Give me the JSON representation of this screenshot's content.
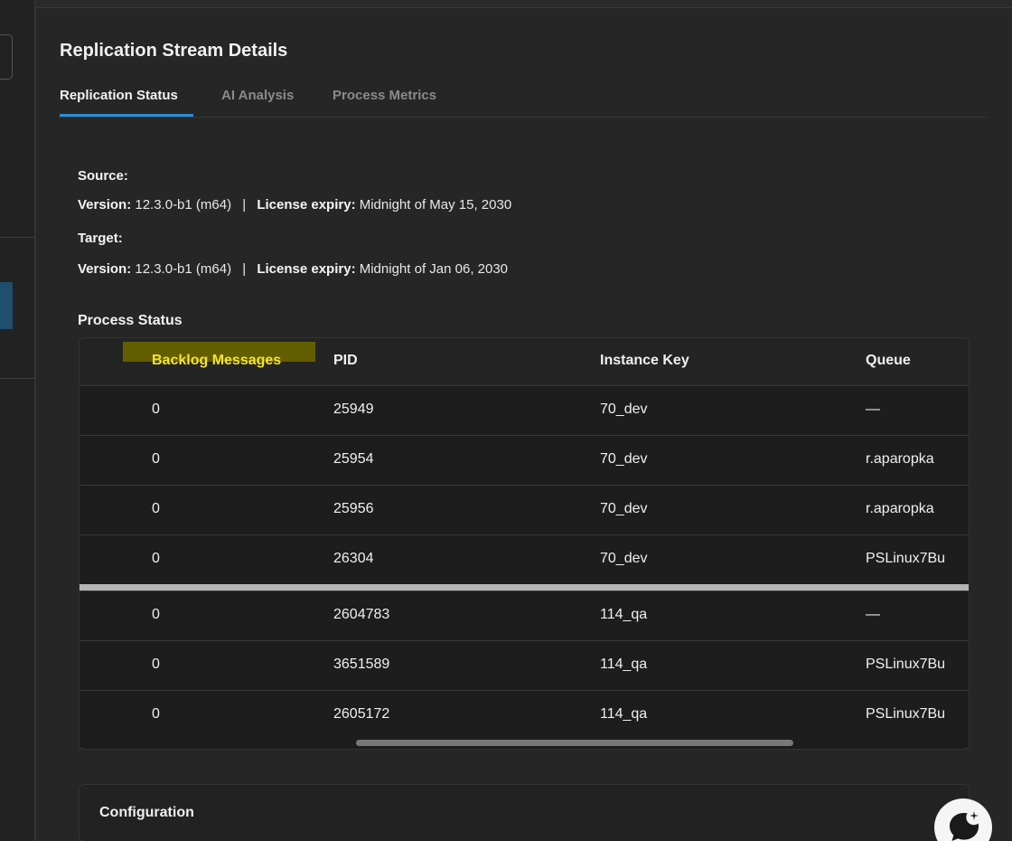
{
  "panel": {
    "title": "Replication Stream Details"
  },
  "tabs": [
    {
      "label": "Replication Status",
      "active": true
    },
    {
      "label": "AI Analysis",
      "active": false
    },
    {
      "label": "Process Metrics",
      "active": false
    }
  ],
  "source": {
    "heading": "Source:",
    "version_label": "Version:",
    "version": "12.3.0-b1 (m64)",
    "separator": "|",
    "license_label": "License expiry:",
    "license": "Midnight of May 15, 2030"
  },
  "target": {
    "heading": "Target:",
    "version_label": "Version:",
    "version": "12.3.0-b1 (m64)",
    "separator": "|",
    "license_label": "License expiry:",
    "license": "Midnight of Jan 06, 2030"
  },
  "process_status": {
    "title": "Process Status",
    "columns": [
      "Backlog Messages",
      "PID",
      "Instance Key",
      "Queue"
    ],
    "rows": [
      {
        "backlog": "0",
        "pid": "25949",
        "instance": "70_dev",
        "queue": "—"
      },
      {
        "backlog": "0",
        "pid": "25954",
        "instance": "70_dev",
        "queue": "r.aparopka"
      },
      {
        "backlog": "0",
        "pid": "25956",
        "instance": "70_dev",
        "queue": "r.aparopka"
      },
      {
        "backlog": "0",
        "pid": "26304",
        "instance": "70_dev",
        "queue": "PSLinux7Bu"
      },
      {
        "backlog": "0",
        "pid": "2604783",
        "instance": "114_qa",
        "queue": "—"
      },
      {
        "backlog": "0",
        "pid": "3651589",
        "instance": "114_qa",
        "queue": "PSLinux7Bu"
      },
      {
        "backlog": "0",
        "pid": "2605172",
        "instance": "114_qa",
        "queue": "PSLinux7Bu"
      }
    ]
  },
  "configuration": {
    "label": "Configuration"
  },
  "colors": {
    "accent": "#2c8ad8",
    "highlight": "#f5e430",
    "background": "#262626"
  },
  "icons": {
    "chat": "chat-bubble-icon",
    "expand": "chevron-icon"
  }
}
